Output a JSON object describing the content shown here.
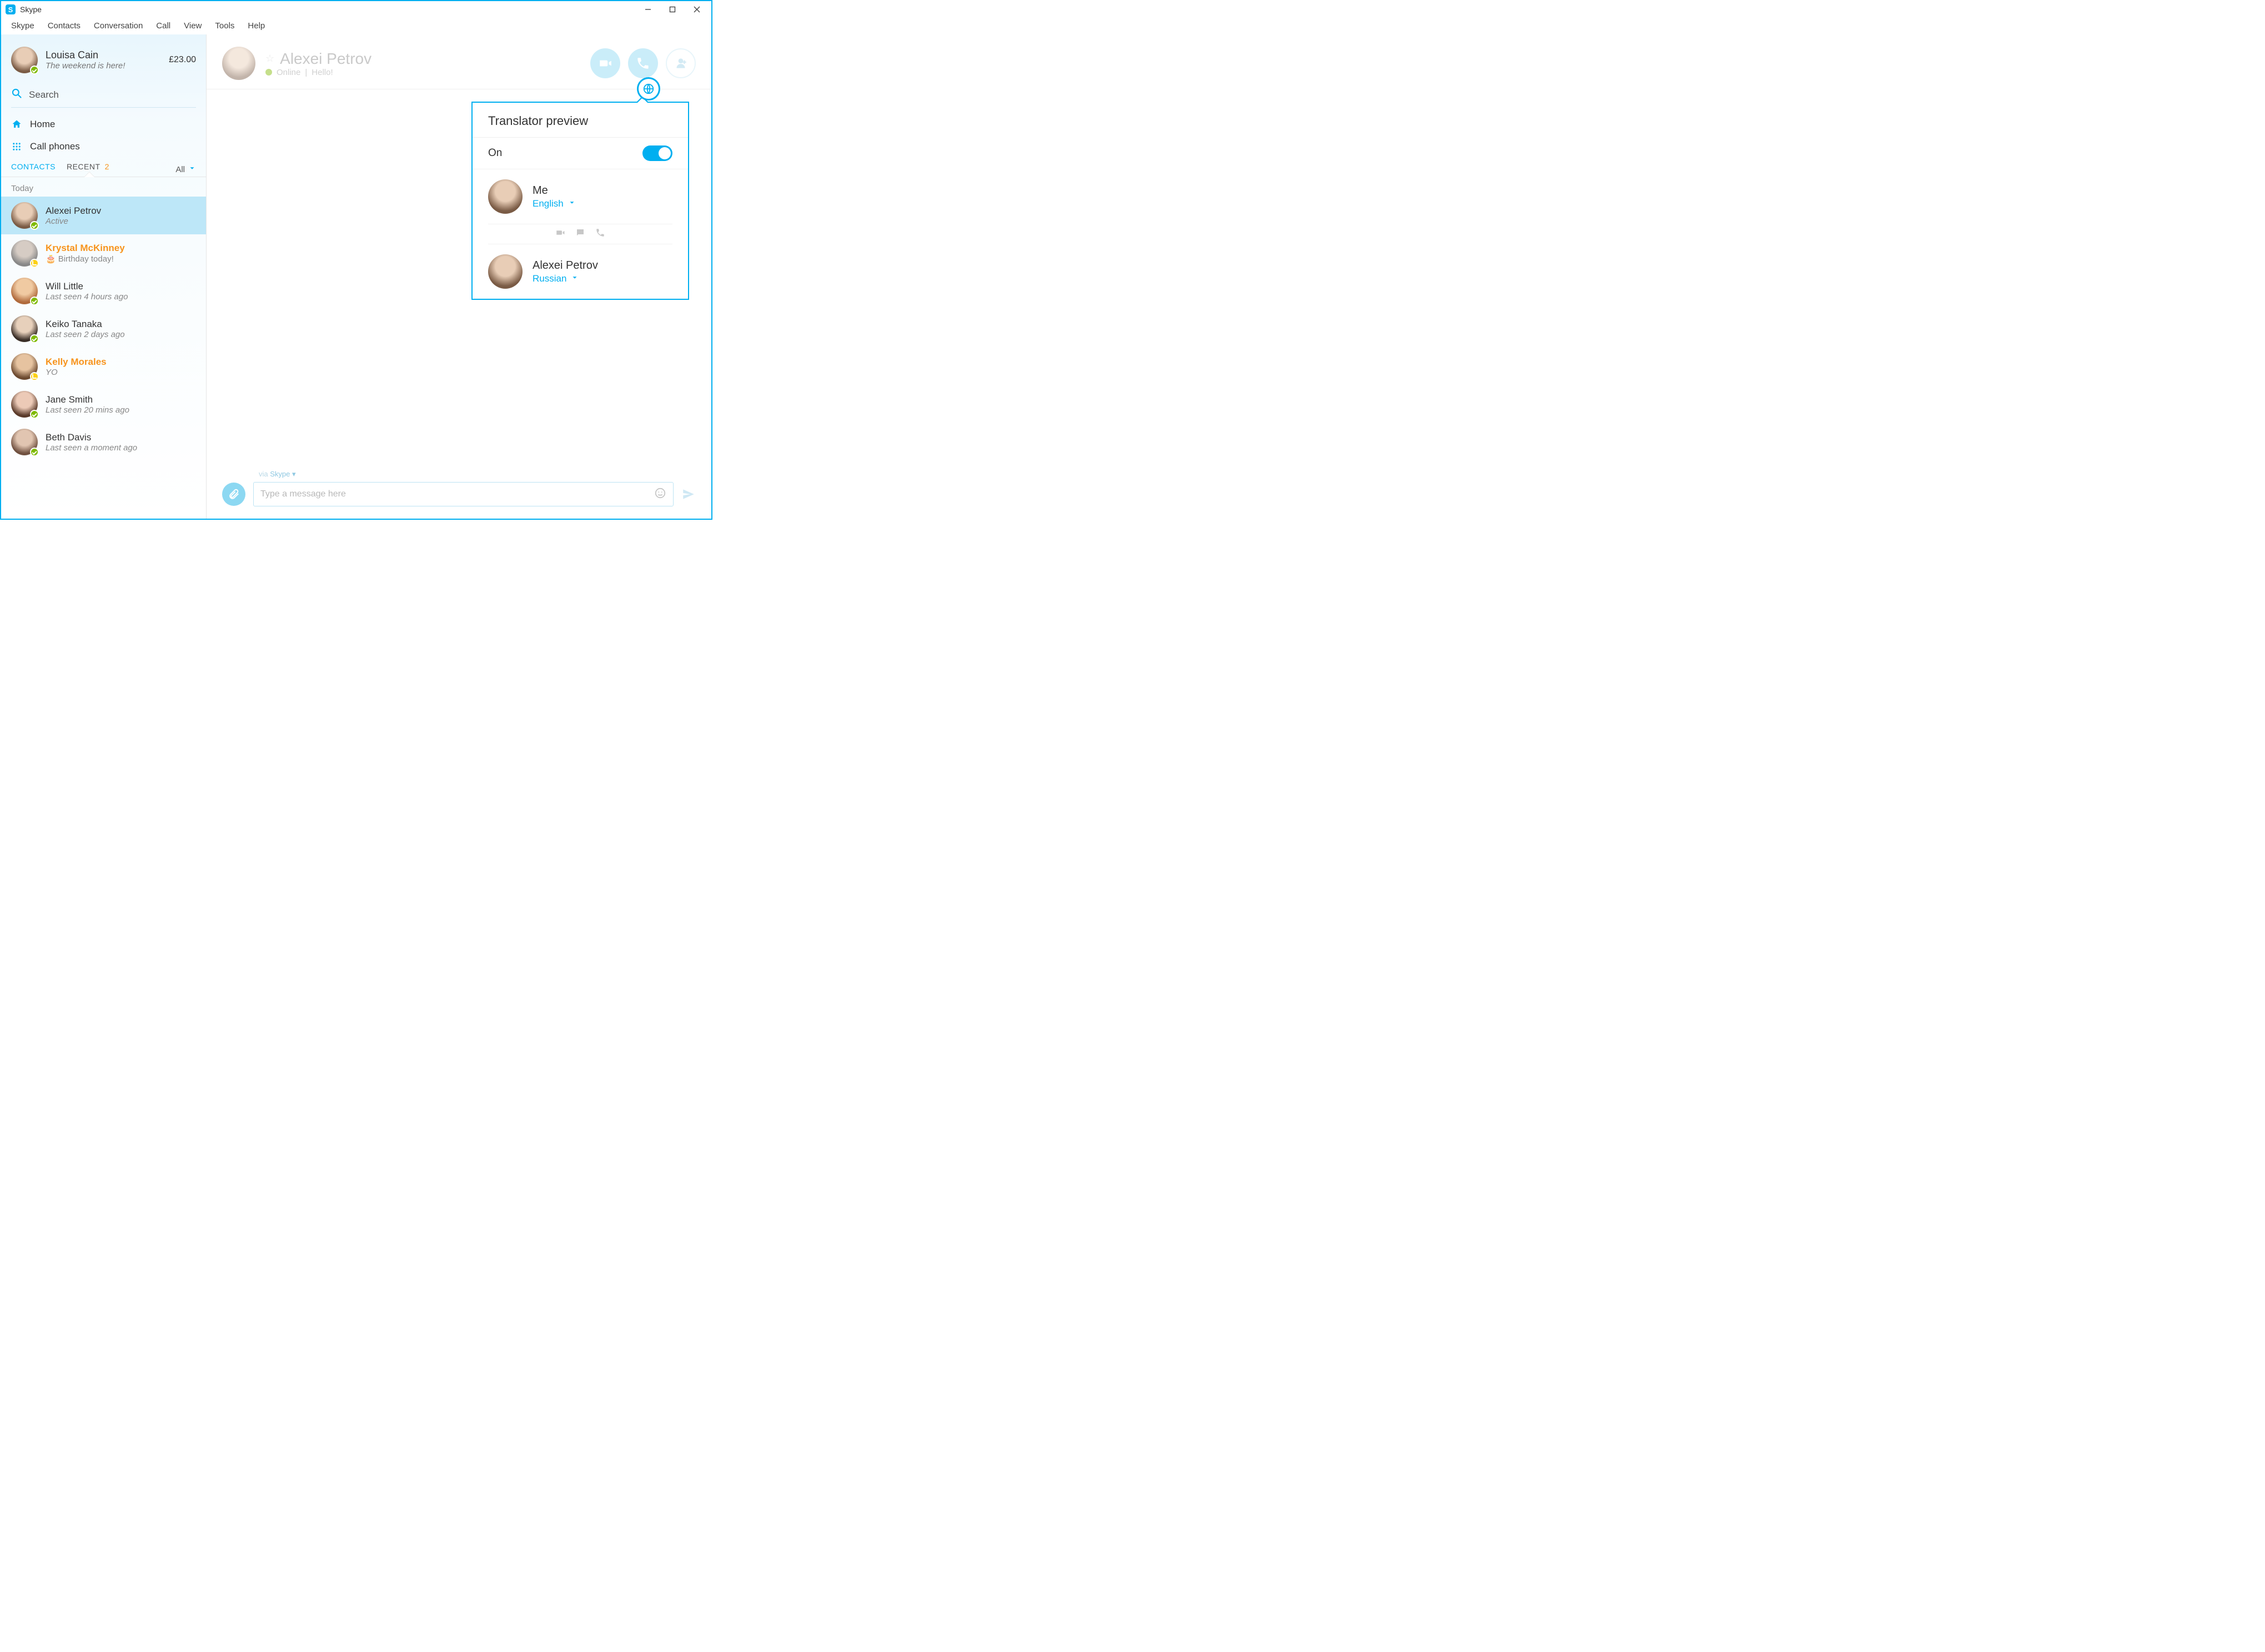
{
  "window": {
    "title": "Skype"
  },
  "menu": [
    "Skype",
    "Contacts",
    "Conversation",
    "Call",
    "View",
    "Tools",
    "Help"
  ],
  "profile": {
    "name": "Louisa Cain",
    "mood": "The weekend is here!",
    "credit": "£23.00"
  },
  "search": {
    "label": "Search"
  },
  "sidelinks": {
    "home": "Home",
    "callphones": "Call phones"
  },
  "tabs": {
    "contacts": "CONTACTS",
    "recent": "RECENT",
    "recent_badge": "2",
    "filter": "All"
  },
  "section_today": "Today",
  "contacts": [
    {
      "name": "Alexei Petrov",
      "sub": "Active",
      "status": "online",
      "highlight": false,
      "selected": true,
      "birthday": false,
      "tint": "tint-a"
    },
    {
      "name": "Krystal McKinney",
      "sub": "Birthday today!",
      "status": "away",
      "highlight": true,
      "selected": false,
      "birthday": true,
      "tint": "tint-b"
    },
    {
      "name": "Will Little",
      "sub": "Last seen 4 hours ago",
      "status": "online",
      "highlight": false,
      "selected": false,
      "birthday": false,
      "tint": "tint-c"
    },
    {
      "name": "Keiko Tanaka",
      "sub": "Last seen 2 days ago",
      "status": "online",
      "highlight": false,
      "selected": false,
      "birthday": false,
      "tint": "tint-d"
    },
    {
      "name": "Kelly Morales",
      "sub": "YO",
      "status": "away",
      "highlight": true,
      "selected": false,
      "birthday": false,
      "tint": "tint-e"
    },
    {
      "name": "Jane Smith",
      "sub": "Last seen 20 mins ago",
      "status": "online",
      "highlight": false,
      "selected": false,
      "birthday": false,
      "tint": "tint-f"
    },
    {
      "name": "Beth Davis",
      "sub": "Last seen a moment ago",
      "status": "online",
      "highlight": false,
      "selected": false,
      "birthday": false,
      "tint": "tint-g"
    }
  ],
  "conversation": {
    "title": "Alexei Petrov",
    "presence": "Online",
    "mood": "Hello!"
  },
  "translator": {
    "title": "Translator preview",
    "state_label": "On",
    "me": {
      "name": "Me",
      "language": "English"
    },
    "them": {
      "name": "Alexei Petrov",
      "language": "Russian"
    }
  },
  "composer": {
    "via_prefix": "via ",
    "via_service": "Skype",
    "placeholder": "Type a message here"
  }
}
